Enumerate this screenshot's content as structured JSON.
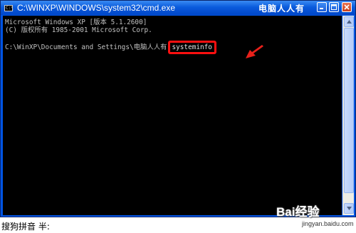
{
  "window": {
    "title": "C:\\WINXP\\WINDOWS\\system32\\cmd.exe",
    "title_watermark": "电脑人人有",
    "icon": "cmd-icon",
    "buttons": [
      "minimize-icon",
      "maximize-icon",
      "close-icon"
    ]
  },
  "console": {
    "line1": "Microsoft Windows XP [版本 5.1.2600]",
    "line2": "(C) 版权所有 1985-2001 Microsoft Corp.",
    "prompt": "C:\\WinXP\\Documents and Settings\\电脑人人有",
    "command": "systeminfo",
    "text_color": "#c0c0c0",
    "background": "#000000",
    "highlight_color": "#ff1010"
  },
  "annotation": {
    "arrow_icon": "red-arrow-icon",
    "color": "#e8201a"
  },
  "ime": {
    "status": "搜狗拼音 半:"
  },
  "watermark": {
    "logo": "Bai经验",
    "url": "jingyan.baidu.com"
  }
}
